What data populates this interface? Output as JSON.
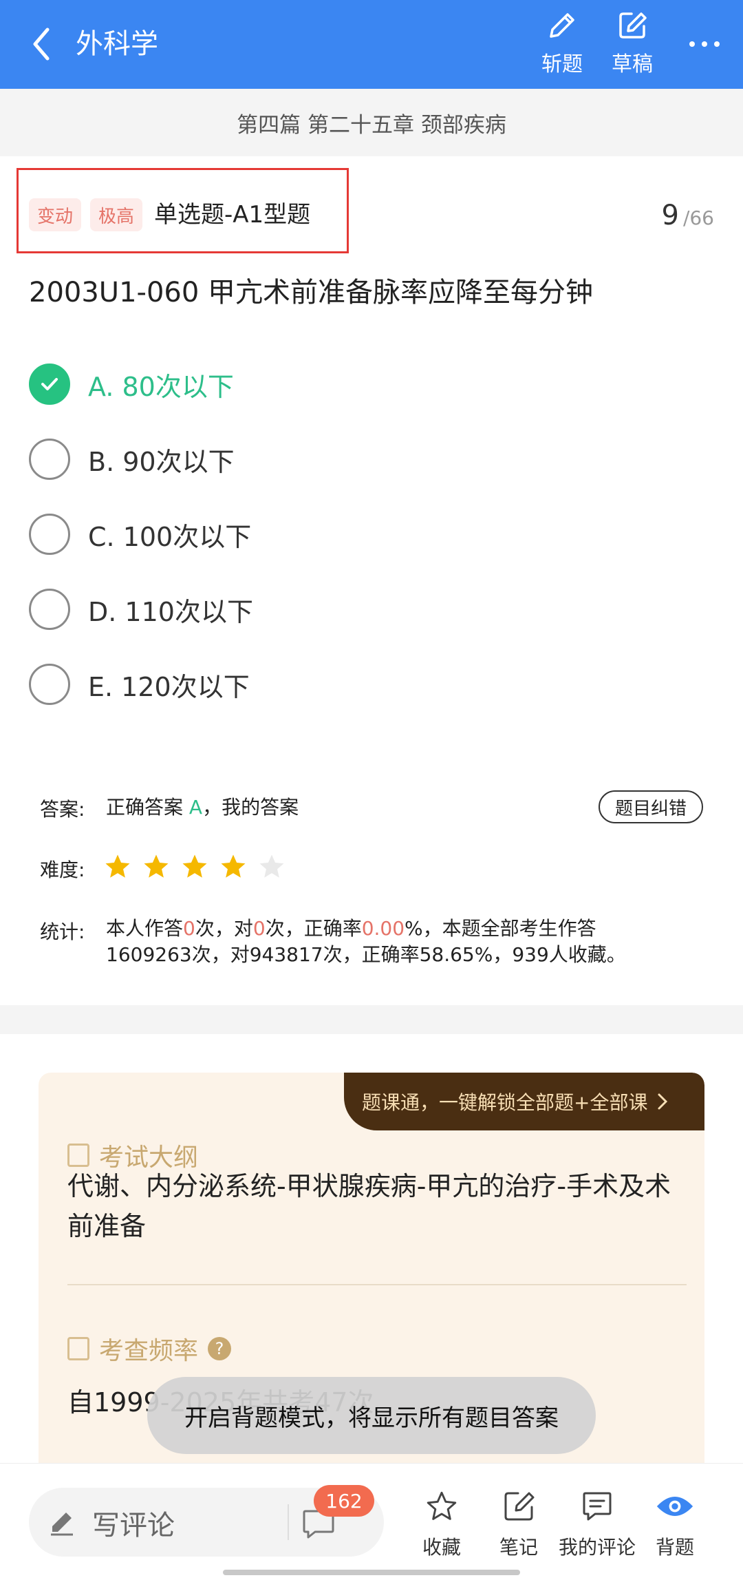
{
  "header": {
    "title": "外科学",
    "actions": [
      {
        "label": "斩题",
        "icon": "pencil-icon"
      },
      {
        "label": "草稿",
        "icon": "edit-note-icon"
      }
    ],
    "more_icon": "more-icon"
  },
  "chapter": "第四篇 第二十五章 颈部疾病",
  "question": {
    "tags": [
      "变动",
      "极高"
    ],
    "type": "单选题-A1型题",
    "number": "9",
    "total": "/66",
    "stem": "2003U1-060 甲亢术前准备脉率应降至每分钟",
    "options": [
      {
        "text": "A. 80次以下",
        "checked": true
      },
      {
        "text": "B. 90次以下",
        "checked": false
      },
      {
        "text": "C. 100次以下",
        "checked": false
      },
      {
        "text": "D. 110次以下",
        "checked": false
      },
      {
        "text": "E. 120次以下",
        "checked": false
      }
    ]
  },
  "answer": {
    "label": "答案:",
    "prefix": "正确答案",
    "correct": "A",
    "suffix": "，我的答案",
    "report_button": "题目纠错"
  },
  "difficulty": {
    "label": "难度:",
    "stars_filled": 4,
    "stars_total": 5,
    "star_color": "#f5b800"
  },
  "stats": {
    "label": "统计:",
    "p1": "本人作答",
    "v1": "0",
    "p2": "次，对",
    "v2": "0",
    "p3": "次，正确率",
    "v3": "0.00",
    "p4": "%，本题全部考生作答",
    "line2": "1609263次，对943817次，正确率58.65%，939人收藏。"
  },
  "card": {
    "promo": "题课通，一键解锁全部题+全部课",
    "outline_title": "考试大纲",
    "outline_body": "代谢、内分泌系统-甲状腺疾病-甲亢的治疗-手术及术前准备",
    "freq_title": "考查频率",
    "freq_body": "自1999-2025年共考47次"
  },
  "toast": "开启背题模式，将显示所有题目答案",
  "bottom": {
    "comment_placeholder": "写评论",
    "comment_count": "162",
    "items": [
      {
        "label": "收藏",
        "icon": "star-icon"
      },
      {
        "label": "笔记",
        "icon": "note-icon"
      },
      {
        "label": "我的评论",
        "icon": "comment-icon"
      },
      {
        "label": "背题",
        "icon": "eye-icon"
      }
    ]
  },
  "colors": {
    "header_bg": "#3b86f2",
    "correct_green": "#2dbe8a",
    "highlight_red": "#e53935",
    "accent_orange": "#f26b4f"
  }
}
